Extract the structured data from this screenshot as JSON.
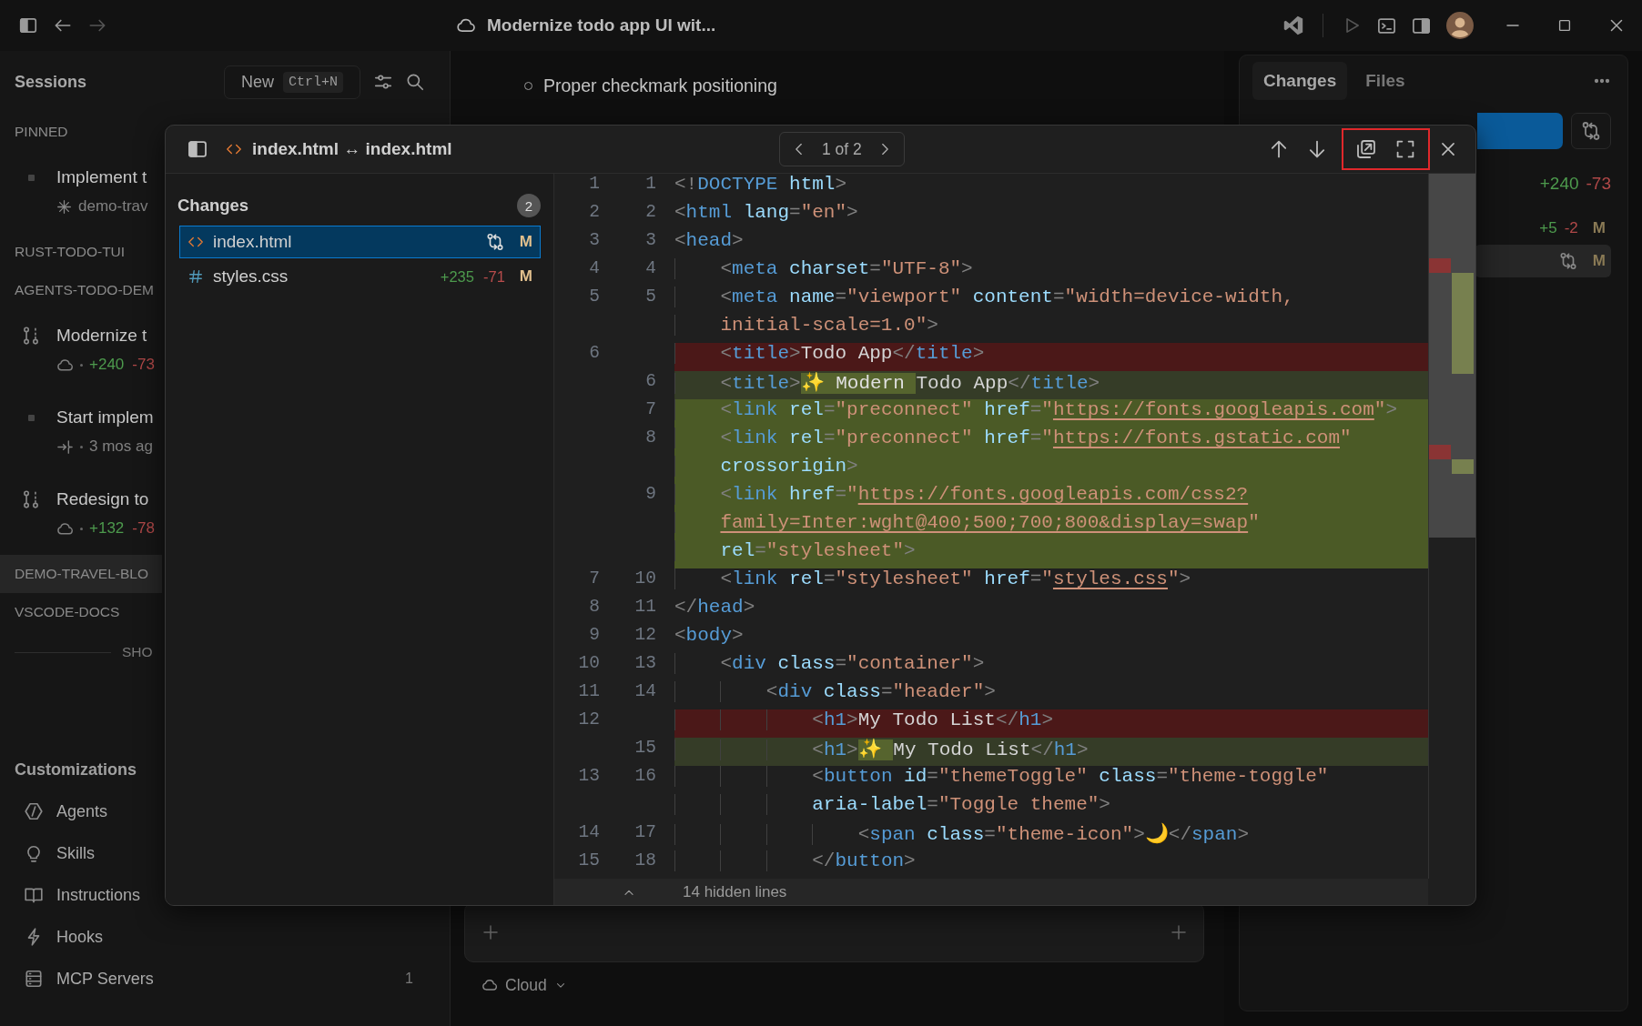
{
  "title_bar": {
    "title": "Modernize todo app UI wit..."
  },
  "sidebar": {
    "title": "Sessions",
    "new_button": {
      "label": "New",
      "shortcut": "Ctrl+N"
    },
    "sections": [
      {
        "label": "PINNED",
        "selected": false,
        "sessions": [
          {
            "kind": "draft",
            "title": "Implement t",
            "meta": {
              "kind": "agent",
              "text": "demo-trav"
            }
          }
        ]
      },
      {
        "label": "RUST-TODO-TUI",
        "selected": false
      },
      {
        "label": "AGENTS-TODO-DEM",
        "selected": false,
        "sessions": [
          {
            "kind": "cloud",
            "title": "Modernize t",
            "meta": {
              "kind": "cloud",
              "added": "+240",
              "removed": "-73"
            }
          },
          {
            "kind": "draft",
            "title": "Start implem",
            "meta": {
              "kind": "handoff",
              "text": "3 mos ag"
            }
          },
          {
            "kind": "cloud",
            "title": "Redesign to",
            "meta": {
              "kind": "cloud",
              "added": "+132",
              "removed": "-78"
            }
          }
        ]
      },
      {
        "label": "DEMO-TRAVEL-BLO",
        "selected": true
      },
      {
        "label": "VSCODE-DOCS",
        "selected": false
      }
    ],
    "show_more": "SHO",
    "customizations": {
      "title": "Customizations",
      "items": [
        {
          "kind": "agents",
          "label": "Agents"
        },
        {
          "kind": "skills",
          "label": "Skills"
        },
        {
          "kind": "instructions",
          "label": "Instructions"
        },
        {
          "kind": "hooks",
          "label": "Hooks"
        },
        {
          "kind": "mcp",
          "label": "MCP Servers",
          "count": "1"
        }
      ]
    }
  },
  "chat": {
    "bullets": [
      "Proper checkmark positioning"
    ],
    "mode": "Cloud"
  },
  "changes_panel": {
    "tabs": [
      {
        "label": "Changes",
        "selected": true
      },
      {
        "label": "Files",
        "selected": false
      }
    ],
    "total": {
      "added": "+240",
      "removed": "-73"
    },
    "files": [
      {
        "added": "+5",
        "removed": "-2",
        "status": "M",
        "selected": false
      },
      {
        "status": "M",
        "selected": true
      }
    ]
  },
  "diff": {
    "title": "index.html ↔ index.html",
    "pager": "1 of 2",
    "frame_highlighted": true,
    "changes_title": "Changes",
    "change_count": "2",
    "files": [
      {
        "kind": "html",
        "name": "index.html",
        "status": "M",
        "selected": true
      },
      {
        "kind": "css",
        "name": "styles.css",
        "added": "+235",
        "removed": "-71",
        "status": "M",
        "selected": false
      }
    ],
    "rows": [
      {
        "old": "1",
        "new": "1",
        "kind": "context",
        "selected": false,
        "tokens": [
          {
            "kind": "p",
            "text": "<!"
          },
          {
            "kind": "tag",
            "text": "DOCTYPE"
          },
          {
            "kind": "attr",
            "text": " html"
          },
          {
            "kind": "p",
            "text": ">"
          }
        ]
      },
      {
        "old": "2",
        "new": "2",
        "kind": "context",
        "selected": false,
        "tokens": [
          {
            "kind": "p",
            "text": "<"
          },
          {
            "kind": "tag",
            "text": "html"
          },
          {
            "kind": "attr",
            "text": " lang"
          },
          {
            "kind": "p",
            "text": "="
          },
          {
            "kind": "str",
            "text": "\"en\""
          },
          {
            "kind": "p",
            "text": ">"
          }
        ]
      },
      {
        "old": "3",
        "new": "3",
        "kind": "context",
        "selected": false,
        "tokens": [
          {
            "kind": "p",
            "text": "<"
          },
          {
            "kind": "tag",
            "text": "head"
          },
          {
            "kind": "p",
            "text": ">"
          }
        ]
      },
      {
        "old": "4",
        "new": "4",
        "kind": "context",
        "selected": false,
        "tokens": [
          {
            "kind": "p",
            "text": "    <"
          },
          {
            "kind": "tag",
            "text": "meta"
          },
          {
            "kind": "attr",
            "text": " charset"
          },
          {
            "kind": "p",
            "text": "="
          },
          {
            "kind": "str",
            "text": "\"UTF-8\""
          },
          {
            "kind": "p",
            "text": ">"
          }
        ]
      },
      {
        "old": "5",
        "new": "5",
        "kind": "context",
        "selected": false,
        "tokens": [
          {
            "kind": "p",
            "text": "    <"
          },
          {
            "kind": "tag",
            "text": "meta"
          },
          {
            "kind": "attr",
            "text": " name"
          },
          {
            "kind": "p",
            "text": "="
          },
          {
            "kind": "str",
            "text": "\"viewport\""
          },
          {
            "kind": "attr",
            "text": " content"
          },
          {
            "kind": "p",
            "text": "="
          },
          {
            "kind": "str",
            "text": "\"width=device-width,"
          }
        ]
      },
      {
        "kind": "context",
        "selected": false,
        "tokens": [
          {
            "kind": "str",
            "text": "    initial-scale=1.0\""
          },
          {
            "kind": "p",
            "text": ">"
          }
        ]
      },
      {
        "old": "6",
        "kind": "removed",
        "selected": false,
        "tokens": [
          {
            "kind": "p",
            "text": "    <"
          },
          {
            "kind": "tag",
            "text": "title"
          },
          {
            "kind": "p",
            "text": ">"
          },
          {
            "kind": "text",
            "text": "Todo App"
          },
          {
            "kind": "p",
            "text": "</"
          },
          {
            "kind": "tag",
            "text": "title"
          },
          {
            "kind": "p",
            "text": ">"
          }
        ]
      },
      {
        "new": "6",
        "kind": "added",
        "selected": false,
        "tokens": [
          {
            "kind": "p",
            "text": "    <"
          },
          {
            "kind": "tag",
            "text": "title"
          },
          {
            "kind": "p",
            "text": ">"
          },
          {
            "kind": "inserted",
            "text": "✨ Modern "
          },
          {
            "kind": "text",
            "text": "Todo App"
          },
          {
            "kind": "p",
            "text": "</"
          },
          {
            "kind": "tag",
            "text": "title"
          },
          {
            "kind": "p",
            "text": ">"
          }
        ]
      },
      {
        "new": "7",
        "kind": "added",
        "selected": true,
        "tokens": [
          {
            "kind": "p",
            "text": "    <"
          },
          {
            "kind": "tag",
            "text": "link"
          },
          {
            "kind": "attr",
            "text": " rel"
          },
          {
            "kind": "p",
            "text": "="
          },
          {
            "kind": "str",
            "text": "\"preconnect\""
          },
          {
            "kind": "attr",
            "text": " href"
          },
          {
            "kind": "p",
            "text": "="
          },
          {
            "kind": "str",
            "text": "\""
          },
          {
            "kind": "link",
            "text": "https://fonts.googleapis.com"
          },
          {
            "kind": "str",
            "text": "\""
          },
          {
            "kind": "p",
            "text": ">"
          }
        ]
      },
      {
        "new": "8",
        "kind": "added",
        "selected": true,
        "tokens": [
          {
            "kind": "p",
            "text": "    <"
          },
          {
            "kind": "tag",
            "text": "link"
          },
          {
            "kind": "attr",
            "text": " rel"
          },
          {
            "kind": "p",
            "text": "="
          },
          {
            "kind": "str",
            "text": "\"preconnect\""
          },
          {
            "kind": "attr",
            "text": " href"
          },
          {
            "kind": "p",
            "text": "="
          },
          {
            "kind": "str",
            "text": "\""
          },
          {
            "kind": "link",
            "text": "https://fonts.gstatic.com"
          },
          {
            "kind": "str",
            "text": "\""
          }
        ]
      },
      {
        "kind": "added",
        "selected": true,
        "tokens": [
          {
            "kind": "attr",
            "text": "    crossorigin"
          },
          {
            "kind": "p",
            "text": ">"
          }
        ]
      },
      {
        "new": "9",
        "kind": "added",
        "selected": true,
        "tokens": [
          {
            "kind": "p",
            "text": "    <"
          },
          {
            "kind": "tag",
            "text": "link"
          },
          {
            "kind": "attr",
            "text": " href"
          },
          {
            "kind": "p",
            "text": "="
          },
          {
            "kind": "str",
            "text": "\""
          },
          {
            "kind": "link",
            "text": "https://fonts.googleapis.com/css2?"
          }
        ]
      },
      {
        "kind": "added",
        "selected": true,
        "tokens": [
          {
            "kind": "link",
            "text": "    family=Inter:wght@400;500;700;800&display=swap"
          },
          {
            "kind": "str",
            "text": "\""
          }
        ]
      },
      {
        "kind": "added",
        "selected": true,
        "tokens": [
          {
            "kind": "attr",
            "text": "    rel"
          },
          {
            "kind": "p",
            "text": "="
          },
          {
            "kind": "str",
            "text": "\"stylesheet\""
          },
          {
            "kind": "p",
            "text": ">"
          }
        ]
      },
      {
        "old": "7",
        "new": "10",
        "kind": "context",
        "selected": false,
        "tokens": [
          {
            "kind": "p",
            "text": "    <"
          },
          {
            "kind": "tag",
            "text": "link"
          },
          {
            "kind": "attr",
            "text": " rel"
          },
          {
            "kind": "p",
            "text": "="
          },
          {
            "kind": "str",
            "text": "\"stylesheet\""
          },
          {
            "kind": "attr",
            "text": " href"
          },
          {
            "kind": "p",
            "text": "="
          },
          {
            "kind": "str",
            "text": "\""
          },
          {
            "kind": "link",
            "text": "styles.css"
          },
          {
            "kind": "str",
            "text": "\""
          },
          {
            "kind": "p",
            "text": ">"
          }
        ]
      },
      {
        "old": "8",
        "new": "11",
        "kind": "context",
        "selected": false,
        "tokens": [
          {
            "kind": "p",
            "text": "</"
          },
          {
            "kind": "tag",
            "text": "head"
          },
          {
            "kind": "p",
            "text": ">"
          }
        ]
      },
      {
        "old": "9",
        "new": "12",
        "kind": "context",
        "selected": false,
        "tokens": [
          {
            "kind": "p",
            "text": "<"
          },
          {
            "kind": "tag",
            "text": "body"
          },
          {
            "kind": "p",
            "text": ">"
          }
        ]
      },
      {
        "old": "10",
        "new": "13",
        "kind": "context",
        "selected": false,
        "tokens": [
          {
            "kind": "p",
            "text": "    <"
          },
          {
            "kind": "tag",
            "text": "div"
          },
          {
            "kind": "attr",
            "text": " class"
          },
          {
            "kind": "p",
            "text": "="
          },
          {
            "kind": "str",
            "text": "\"container\""
          },
          {
            "kind": "p",
            "text": ">"
          }
        ]
      },
      {
        "old": "11",
        "new": "14",
        "kind": "context",
        "selected": false,
        "tokens": [
          {
            "kind": "p",
            "text": "        <"
          },
          {
            "kind": "tag",
            "text": "div"
          },
          {
            "kind": "attr",
            "text": " class"
          },
          {
            "kind": "p",
            "text": "="
          },
          {
            "kind": "str",
            "text": "\"header\""
          },
          {
            "kind": "p",
            "text": ">"
          }
        ]
      },
      {
        "old": "12",
        "kind": "removed",
        "selected": false,
        "tokens": [
          {
            "kind": "p",
            "text": "            <"
          },
          {
            "kind": "tag",
            "text": "h1"
          },
          {
            "kind": "p",
            "text": ">"
          },
          {
            "kind": "text",
            "text": "My Todo List"
          },
          {
            "kind": "p",
            "text": "</"
          },
          {
            "kind": "tag",
            "text": "h1"
          },
          {
            "kind": "p",
            "text": ">"
          }
        ]
      },
      {
        "new": "15",
        "kind": "added",
        "selected": false,
        "tokens": [
          {
            "kind": "p",
            "text": "            <"
          },
          {
            "kind": "tag",
            "text": "h1"
          },
          {
            "kind": "p",
            "text": ">"
          },
          {
            "kind": "inserted",
            "text": "✨ "
          },
          {
            "kind": "text",
            "text": "My Todo List"
          },
          {
            "kind": "p",
            "text": "</"
          },
          {
            "kind": "tag",
            "text": "h1"
          },
          {
            "kind": "p",
            "text": ">"
          }
        ]
      },
      {
        "old": "13",
        "new": "16",
        "kind": "context",
        "selected": false,
        "tokens": [
          {
            "kind": "p",
            "text": "            <"
          },
          {
            "kind": "tag",
            "text": "button"
          },
          {
            "kind": "attr",
            "text": " id"
          },
          {
            "kind": "p",
            "text": "="
          },
          {
            "kind": "str",
            "text": "\"themeToggle\""
          },
          {
            "kind": "attr",
            "text": " class"
          },
          {
            "kind": "p",
            "text": "="
          },
          {
            "kind": "str",
            "text": "\"theme-toggle\""
          }
        ]
      },
      {
        "kind": "context",
        "selected": false,
        "tokens": [
          {
            "kind": "attr",
            "text": "            aria-label"
          },
          {
            "kind": "p",
            "text": "="
          },
          {
            "kind": "str",
            "text": "\"Toggle theme\""
          },
          {
            "kind": "p",
            "text": ">"
          }
        ]
      },
      {
        "old": "14",
        "new": "17",
        "kind": "context",
        "selected": false,
        "tokens": [
          {
            "kind": "p",
            "text": "                <"
          },
          {
            "kind": "tag",
            "text": "span"
          },
          {
            "kind": "attr",
            "text": " class"
          },
          {
            "kind": "p",
            "text": "="
          },
          {
            "kind": "str",
            "text": "\"theme-icon\""
          },
          {
            "kind": "p",
            "text": ">"
          },
          {
            "kind": "text",
            "text": "🌙"
          },
          {
            "kind": "p",
            "text": "</"
          },
          {
            "kind": "tag",
            "text": "span"
          },
          {
            "kind": "p",
            "text": ">"
          }
        ]
      },
      {
        "old": "15",
        "new": "18",
        "kind": "context",
        "selected": false,
        "tokens": [
          {
            "kind": "p",
            "text": "            </"
          },
          {
            "kind": "tag",
            "text": "button"
          },
          {
            "kind": "p",
            "text": ">"
          }
        ]
      }
    ],
    "hidden_lines": "14 hidden lines"
  }
}
